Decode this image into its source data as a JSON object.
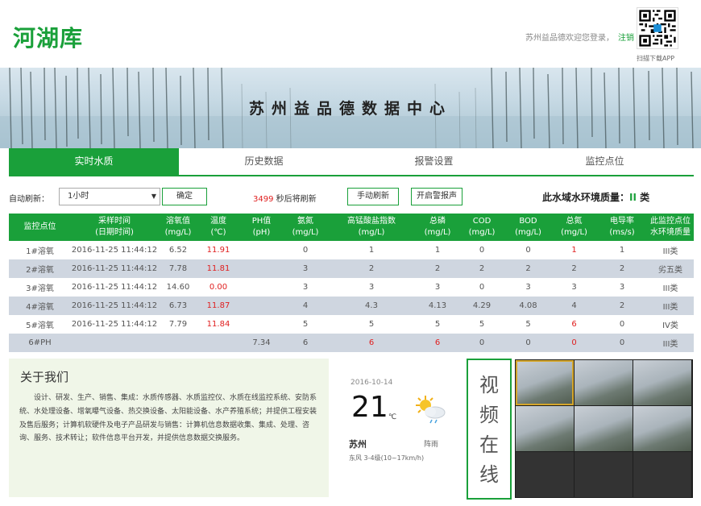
{
  "header": {
    "logo": "河湖库",
    "welcome": "苏州益品德欢迎您登录，",
    "logout": "注销",
    "qr_caption": "扫描下载APP"
  },
  "banner": {
    "title": "苏州益品德数据中心"
  },
  "tabs": [
    "实时水质",
    "历史数据",
    "报警设置",
    "监控点位"
  ],
  "controls": {
    "auto_refresh_label": "自动刷新：",
    "interval": "1小时",
    "confirm": "确定",
    "countdown_value": "3499",
    "countdown_suffix": " 秒后将刷新",
    "manual_refresh": "手动刷新",
    "alarm_on": "开启警报声",
    "quality_label": "此水域水环境质量：",
    "quality_grade": "II",
    "quality_suffix": " 类"
  },
  "table": {
    "headers": [
      [
        "监控点位",
        ""
      ],
      [
        "采样时间",
        "(日期时间)"
      ],
      [
        "溶氧值",
        "(mg/L)"
      ],
      [
        "温度",
        "(℃)"
      ],
      [
        "PH值",
        "(pH)"
      ],
      [
        "氨氮",
        "(mg/L)"
      ],
      [
        "高锰酸盐指数",
        "(mg/L)"
      ],
      [
        "总磷",
        "(mg/L)"
      ],
      [
        "COD",
        "(mg/L)"
      ],
      [
        "BOD",
        "(mg/L)"
      ],
      [
        "总氮",
        "(mg/L)"
      ],
      [
        "电导率",
        "(ms/s)"
      ],
      [
        "此监控点位",
        "水环境质量"
      ]
    ],
    "rows": [
      [
        "1#溶氧",
        "2016-11-25 11:44:12",
        "6.52",
        "11.91",
        "",
        "0",
        "1",
        "1",
        "0",
        "0",
        "1",
        "1",
        "III类"
      ],
      [
        "2#溶氧",
        "2016-11-25 11:44:12",
        "7.78",
        "11.81",
        "",
        "3",
        "2",
        "2",
        "2",
        "2",
        "2",
        "2",
        "劣五类"
      ],
      [
        "3#溶氧",
        "2016-11-25 11:44:12",
        "14.60",
        "0.00",
        "",
        "3",
        "3",
        "3",
        "0",
        "3",
        "3",
        "3",
        "III类"
      ],
      [
        "4#溶氧",
        "2016-11-25 11:44:12",
        "6.73",
        "11.87",
        "",
        "4",
        "4.3",
        "4.13",
        "4.29",
        "4.08",
        "4",
        "2",
        "III类"
      ],
      [
        "5#溶氧",
        "2016-11-25 11:44:12",
        "7.79",
        "11.84",
        "",
        "5",
        "5",
        "5",
        "5",
        "5",
        "6",
        "0",
        "IV类"
      ],
      [
        "6#PH",
        "",
        "",
        "",
        "7.34",
        "6",
        "6",
        "6",
        "0",
        "0",
        "0",
        "0",
        "III类"
      ]
    ],
    "red_cells": [
      [
        0,
        3
      ],
      [
        0,
        10
      ],
      [
        1,
        3
      ],
      [
        2,
        3
      ],
      [
        3,
        3
      ],
      [
        4,
        3
      ],
      [
        4,
        10
      ],
      [
        5,
        6
      ],
      [
        5,
        7
      ],
      [
        5,
        10
      ]
    ]
  },
  "about": {
    "title": "关于我们",
    "text": "设计、研发、生产、销售、集成：水质传感器、水质监控仪、水质在线监控系统、安防系统、水处理设备、增氧曝气设备、热交换设备、太阳能设备、水产养殖系统；并提供工程安装及售后服务；计算机软硬件及电子产品研发与销售：计算机信息数据收集、集成、处理、咨询、服务、技术转让；软件信息平台开发，并提供信息数据交换服务。"
  },
  "weather": {
    "date": "2016-10-14",
    "temp": "21",
    "unit": "℃",
    "city": "苏州",
    "condition": "阵雨",
    "wind": "东风 3-4级(10~17km/h)",
    "icon": "sun-cloud-rain-icon"
  },
  "video": {
    "label": [
      "视",
      "频",
      "在",
      "线"
    ],
    "active_cameras": 6,
    "total_slots": 9
  },
  "colors": {
    "accent": "#1aa03a",
    "alert": "#e02020",
    "row_alt": "#cfd6e0"
  }
}
